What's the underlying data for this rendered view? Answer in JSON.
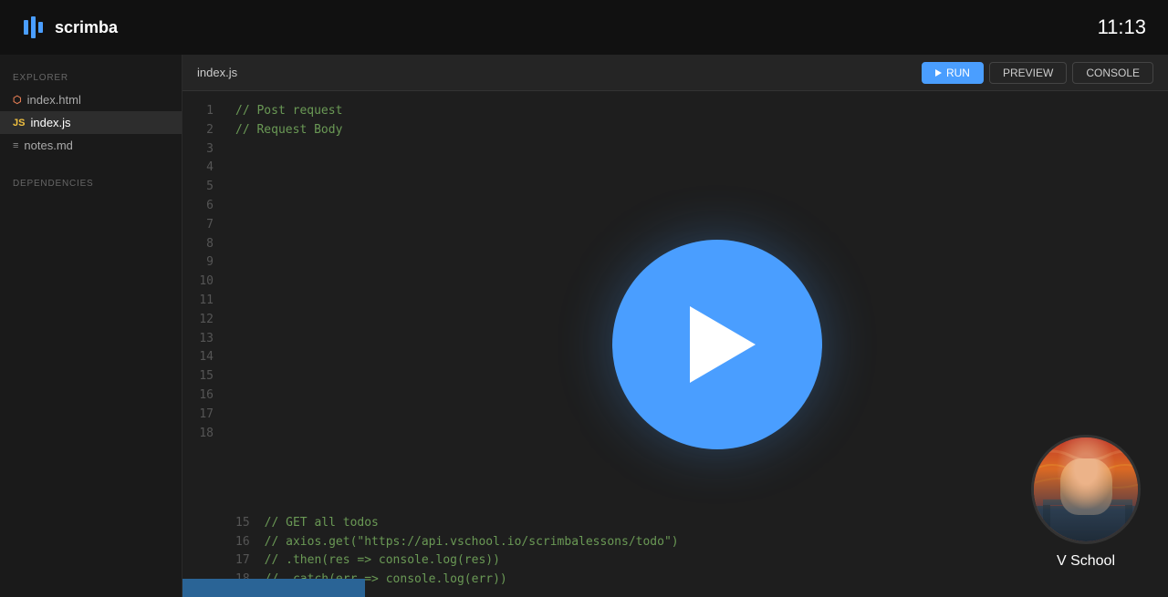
{
  "topbar": {
    "logo_text": "scrimba",
    "clock": "11:13"
  },
  "sidebar": {
    "explorer_label": "EXPLORER",
    "dependencies_label": "DEPENDENCIES",
    "files": [
      {
        "name": "index.html",
        "type": "html",
        "active": false,
        "icon": "html-icon"
      },
      {
        "name": "index.js",
        "type": "js",
        "active": true,
        "icon": "js-icon"
      },
      {
        "name": "notes.md",
        "type": "md",
        "active": false,
        "icon": "md-icon"
      }
    ]
  },
  "editor": {
    "filename": "index.js",
    "toolbar": {
      "run_label": "RUN",
      "preview_label": "PREVIEW",
      "console_label": "CONSOLE"
    },
    "lines": [
      {
        "num": 1,
        "text": "// Post request"
      },
      {
        "num": 2,
        "text": "// Request Body"
      },
      {
        "num": 3,
        "text": ""
      },
      {
        "num": 4,
        "text": ""
      },
      {
        "num": 5,
        "text": ""
      },
      {
        "num": 6,
        "text": ""
      },
      {
        "num": 7,
        "text": ""
      },
      {
        "num": 8,
        "text": ""
      },
      {
        "num": 9,
        "text": ""
      },
      {
        "num": 10,
        "text": ""
      },
      {
        "num": 11,
        "text": ""
      },
      {
        "num": 12,
        "text": ""
      },
      {
        "num": 13,
        "text": ""
      },
      {
        "num": 14,
        "text": ""
      },
      {
        "num": 15,
        "text": "// GET all todos"
      },
      {
        "num": 16,
        "text": "// axios.get(\"https://api.vschool.io/scrimbalessons/todo\")"
      },
      {
        "num": 17,
        "text": "//     .then(res => console.log(res))"
      },
      {
        "num": 18,
        "text": "//     .catch(err => console.log(err))"
      }
    ]
  },
  "vschool": {
    "label": "V School"
  },
  "icons": {
    "logo": "▪",
    "play": "▶"
  }
}
